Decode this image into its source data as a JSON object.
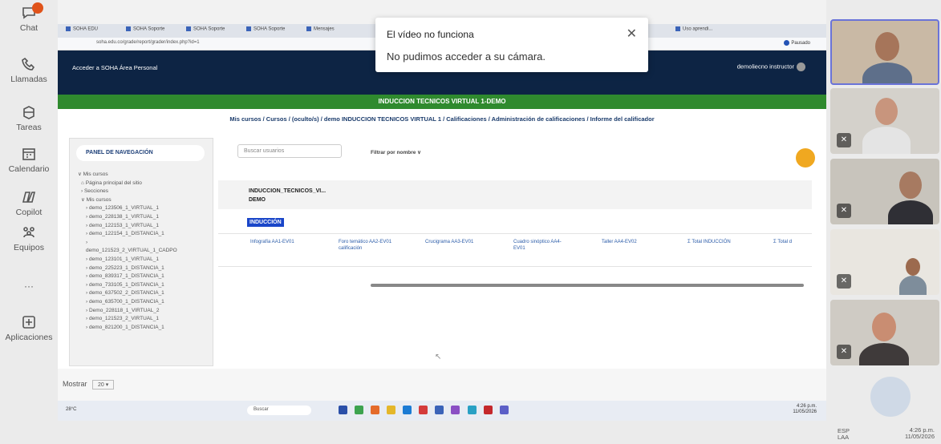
{
  "rail": {
    "items": [
      {
        "label": "Chat",
        "icon": "chat-icon"
      },
      {
        "label": "Llamadas",
        "icon": "phone-icon"
      },
      {
        "label": "Tareas",
        "icon": "tasks-icon"
      },
      {
        "label": "Calendario",
        "icon": "calendar-icon"
      },
      {
        "label": "Copilot",
        "icon": "copilot-icon"
      },
      {
        "label": "Equipos",
        "icon": "teams-icon"
      },
      {
        "label": "···",
        "icon": "more-icon"
      },
      {
        "label": "Aplicaciones",
        "icon": "apps-add-icon"
      }
    ],
    "badge_color": "#e0531a"
  },
  "toast": {
    "title": "El vídeo no funciona",
    "message": "No pudimos acceder a su cámara.",
    "close": "✕"
  },
  "browser": {
    "tabs": [
      "SOHA EDU",
      "SOHA Soporte",
      "SOHA Soporte",
      "SOHA Soporte",
      "Mensajes",
      "Uso aprendi..."
    ],
    "url": "soha.edu.co/grade/report/grader/index.php?id=1",
    "profile": "Pausado"
  },
  "soha": {
    "links": "Acceder a SOHA   Área Personal",
    "user": "demoliecno instructor",
    "banner": "INDUCCION TECNICOS VIRTUAL 1-DEMO",
    "breadcrumb": "Mis cursos / Cursos / (oculto/s) / demo INDUCCION TECNICOS VIRTUAL 1 / Calificaciones / Administración de calificaciones / Informe del calificador"
  },
  "navpanel": {
    "title": "PANEL DE NAVEGACIÓN",
    "items": [
      {
        "text": "∨ Mis cursos",
        "lvl": 0
      },
      {
        "text": "⌂ Página principal del sitio",
        "lvl": 1
      },
      {
        "text": "› Secciones",
        "lvl": 1
      },
      {
        "text": "∨ Mis cursos",
        "lvl": 1
      },
      {
        "text": "› demo_123506_1_VIRTUAL_1",
        "lvl": 2
      },
      {
        "text": "› demo_228138_1_VIRTUAL_1",
        "lvl": 2
      },
      {
        "text": "› demo_122153_1_VIRTUAL_1",
        "lvl": 2
      },
      {
        "text": "› demo_122154_1_DISTANCIA_1",
        "lvl": 2
      },
      {
        "text": "›",
        "lvl": 2
      },
      {
        "text": "demo_121523_2_VIRTUAL_1_CADPO",
        "lvl": 2
      },
      {
        "text": "› demo_123101_1_VIRTUAL_1",
        "lvl": 2
      },
      {
        "text": "› demo_225223_1_DISTANCIA_1",
        "lvl": 2
      },
      {
        "text": "› demo_839317_1_DISTANCIA_1",
        "lvl": 2
      },
      {
        "text": "› demo_733105_1_DISTANCIA_1",
        "lvl": 2
      },
      {
        "text": "› demo_637502_2_DISTANCIA_1",
        "lvl": 2
      },
      {
        "text": "› demo_635700_1_DISTANCIA_1",
        "lvl": 2
      },
      {
        "text": "› Demo_228118_1_VIRTUAL_2",
        "lvl": 2
      },
      {
        "text": "› demo_121523_2_VIRTUAL_1",
        "lvl": 2
      },
      {
        "text": "› demo_821200_1_DISTANCIA_1",
        "lvl": 2
      }
    ]
  },
  "grader": {
    "search_placeholder": "Buscar usuarios",
    "filter": "Filtrar por nombre ∨",
    "course": "INDUCCION_TECNICOS_VI...",
    "course2": "DEMO",
    "category": "INDUCCIÓN",
    "columns": [
      "Infografía AA1-EV01",
      "Foro temático AA2-EV01 calificación",
      "Crucigrama AA3-EV01",
      "Cuadro sinóptico AA4-EV01",
      "Taller AA4-EV02",
      "Σ Total INDUCCIÓN",
      "Σ Total d"
    ],
    "show_label": "Mostrar",
    "show_value": "20"
  },
  "taskbar": {
    "weather": "28°C",
    "search": "Buscar",
    "lang": "ESP",
    "lang2": "LAA",
    "time": "4:26 p.m.",
    "date": "11/05/2026"
  }
}
